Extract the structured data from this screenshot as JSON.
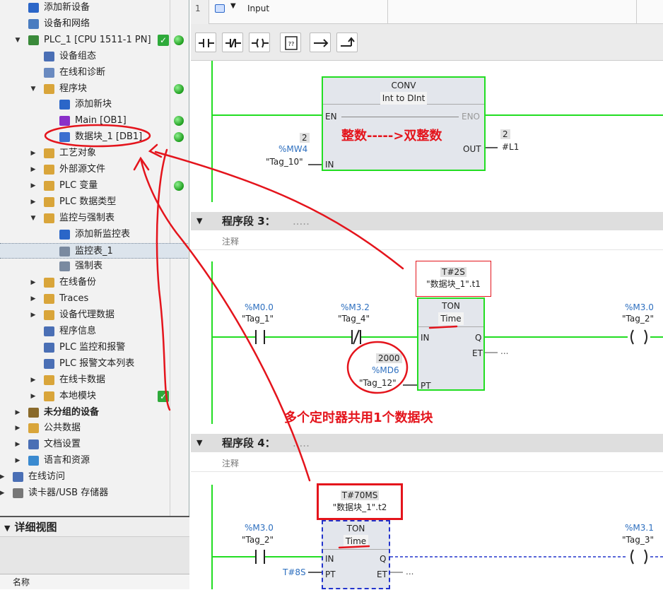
{
  "tree": [
    {
      "label": "添加新设备",
      "icon": "add-device-icon",
      "indent": 40,
      "icolor": "#2b66c8",
      "tw": "",
      "status": ""
    },
    {
      "label": "设备和网络",
      "icon": "network-icon",
      "indent": 40,
      "icolor": "#4a7cc0",
      "tw": "",
      "status": ""
    },
    {
      "label": "PLC_1 [CPU 1511-1 PN]",
      "icon": "plc-icon",
      "indent": 40,
      "icolor": "#3a8a3a",
      "tw": "▼",
      "status": "both"
    },
    {
      "label": "设备组态",
      "icon": "config-icon",
      "indent": 62,
      "icolor": "#4a6fb5",
      "tw": "",
      "status": ""
    },
    {
      "label": "在线和诊断",
      "icon": "diagnostics-icon",
      "indent": 62,
      "icolor": "#6a8ac0",
      "tw": "",
      "status": ""
    },
    {
      "label": "程序块",
      "icon": "folder-icon",
      "indent": 62,
      "icolor": "#d9a53a",
      "tw": "▼",
      "status": "dot"
    },
    {
      "label": "添加新块",
      "icon": "add-block-icon",
      "indent": 84,
      "icolor": "#2b66c8",
      "tw": "",
      "status": ""
    },
    {
      "label": "Main [OB1]",
      "icon": "ob-icon",
      "indent": 84,
      "icolor": "#8a2fc8",
      "tw": "",
      "status": "dot"
    },
    {
      "label": "数据块_1 [DB1]",
      "icon": "db-icon",
      "indent": 84,
      "icolor": "#3b6fd0",
      "tw": "",
      "status": "dot"
    },
    {
      "label": "工艺对象",
      "icon": "folder-icon",
      "indent": 62,
      "icolor": "#d9a53a",
      "tw": "▶",
      "status": ""
    },
    {
      "label": "外部源文件",
      "icon": "folder-icon",
      "indent": 62,
      "icolor": "#d9a53a",
      "tw": "▶",
      "status": ""
    },
    {
      "label": "PLC 变量",
      "icon": "folder-icon",
      "indent": 62,
      "icolor": "#d9a53a",
      "tw": "▶",
      "status": "dot"
    },
    {
      "label": "PLC 数据类型",
      "icon": "folder-icon",
      "indent": 62,
      "icolor": "#d9a53a",
      "tw": "▶",
      "status": ""
    },
    {
      "label": "监控与强制表",
      "icon": "folder-icon",
      "indent": 62,
      "icolor": "#d9a53a",
      "tw": "▼",
      "status": ""
    },
    {
      "label": "添加新监控表",
      "icon": "add-table-icon",
      "indent": 84,
      "icolor": "#2b66c8",
      "tw": "",
      "status": ""
    },
    {
      "label": "监控表_1",
      "icon": "watch-table-icon",
      "indent": 84,
      "icolor": "#7a8aa0",
      "tw": "",
      "status": "",
      "sel": true
    },
    {
      "label": "强制表",
      "icon": "force-table-icon",
      "indent": 84,
      "icolor": "#7a8aa0",
      "tw": "",
      "status": ""
    },
    {
      "label": "在线备份",
      "icon": "folder-icon",
      "indent": 62,
      "icolor": "#d9a53a",
      "tw": "▶",
      "status": ""
    },
    {
      "label": "Traces",
      "icon": "folder-icon",
      "indent": 62,
      "icolor": "#d9a53a",
      "tw": "▶",
      "status": ""
    },
    {
      "label": "设备代理数据",
      "icon": "folder-icon",
      "indent": 62,
      "icolor": "#d9a53a",
      "tw": "▶",
      "status": ""
    },
    {
      "label": "程序信息",
      "icon": "info-icon",
      "indent": 62,
      "icolor": "#4a6fb5",
      "tw": "",
      "status": ""
    },
    {
      "label": "PLC 监控和报警",
      "icon": "alarm-icon",
      "indent": 62,
      "icolor": "#4a6fb5",
      "tw": "",
      "status": ""
    },
    {
      "label": "PLC 报警文本列表",
      "icon": "text-list-icon",
      "indent": 62,
      "icolor": "#4a6fb5",
      "tw": "",
      "status": ""
    },
    {
      "label": "在线卡数据",
      "icon": "folder-icon",
      "indent": 62,
      "icolor": "#d9a53a",
      "tw": "▶",
      "status": ""
    },
    {
      "label": "本地模块",
      "icon": "folder-icon",
      "indent": 62,
      "icolor": "#d9a53a",
      "tw": "▶",
      "status": "check"
    },
    {
      "label": "未分组的设备",
      "icon": "devices-icon",
      "indent": 40,
      "icolor": "#8a6a2a",
      "tw": "▶",
      "status": "",
      "bold": true
    },
    {
      "label": "公共数据",
      "icon": "folder-icon",
      "indent": 40,
      "icolor": "#d9a53a",
      "tw": "▶",
      "status": ""
    },
    {
      "label": "文档设置",
      "icon": "doc-icon",
      "indent": 40,
      "icolor": "#4a6fb5",
      "tw": "▶",
      "status": ""
    },
    {
      "label": "语言和资源",
      "icon": "globe-icon",
      "indent": 40,
      "icolor": "#3a8ad0",
      "tw": "▶",
      "status": ""
    },
    {
      "label": "在线访问",
      "icon": "online-icon",
      "indent": 18,
      "icolor": "#4a6fb5",
      "tw": "▶",
      "status": ""
    },
    {
      "label": "读卡器/USB 存储器",
      "icon": "usb-icon",
      "indent": 18,
      "icolor": "#777",
      "tw": "▶",
      "status": ""
    }
  ],
  "detail": {
    "title": "详细视图",
    "column": "名称"
  },
  "table": {
    "row_num": "1",
    "col_input": "Input"
  },
  "toolbar": {
    "no_contact": "-| |-",
    "nc_contact": "-|/|-",
    "coil": "-( )-",
    "empty_box": "??",
    "open_branch": "→",
    "close_branch": "↵"
  },
  "network3": {
    "title": "程序段 3：",
    "suffix": ".....",
    "comment": "注释"
  },
  "network4": {
    "title": "程序段 4：",
    "suffix": ".....",
    "comment": "注释"
  },
  "conv": {
    "name": "CONV",
    "type": "Int to DInt",
    "en": "EN",
    "eno": "ENO",
    "in": "IN",
    "out": "OUT",
    "in_value": "2",
    "in_addr": "%MW4",
    "in_tag": "\"Tag_10\"",
    "out_value": "2",
    "out_tag": "#L1"
  },
  "ton1": {
    "time": "T#2S",
    "instance": "\"数据块_1\".t1",
    "name": "TON",
    "type": "Time",
    "in": "IN",
    "q": "Q",
    "pt": "PT",
    "et": "ET",
    "et_val": "...",
    "pt_value": "2000",
    "pt_addr": "%MD6",
    "pt_tag": "\"Tag_12\"",
    "c1_addr": "%M0.0",
    "c1_tag": "\"Tag_1\"",
    "c2_addr": "%M3.2",
    "c2_tag": "\"Tag_4\"",
    "coil_addr": "%M3.0",
    "coil_tag": "\"Tag_2\""
  },
  "ton2": {
    "time": "T#70MS",
    "instance": "\"数据块_1\".t2",
    "name": "TON",
    "type": "Time",
    "in": "IN",
    "q": "Q",
    "pt": "PT",
    "et": "ET",
    "et_val": "...",
    "pt_value": "T#8S",
    "c1_addr": "%M3.0",
    "c1_tag": "\"Tag_2\"",
    "coil_addr": "%M3.1",
    "coil_tag": "\"Tag_3\""
  },
  "annotations": {
    "int_to_dint": "整数----->双整数",
    "shared_db": "多个定时器共用1个数据块"
  },
  "colors": {
    "rung": "#22dd22",
    "block_border": "#22dd22",
    "block_bg": "#e3e6ec",
    "annotation": "#e4141c",
    "tag": "#2d6fbf",
    "selected_block": "#2233cc"
  }
}
